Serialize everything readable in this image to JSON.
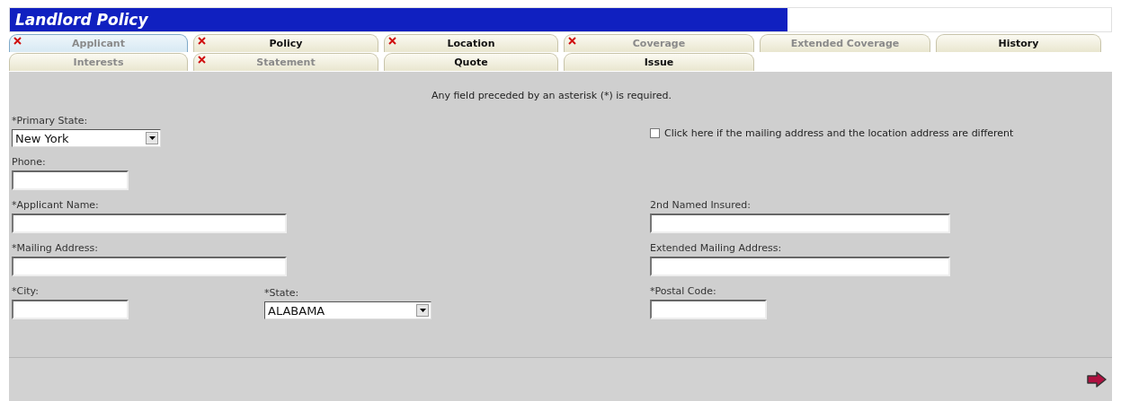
{
  "window": {
    "title": "Landlord Policy"
  },
  "tab_rows": [
    {
      "tabs": [
        {
          "label": "Applicant",
          "selected": true,
          "error": true,
          "disabled": true
        },
        {
          "label": "Policy",
          "selected": false,
          "error": true,
          "disabled": false
        },
        {
          "label": "Location",
          "selected": false,
          "error": true,
          "disabled": false
        },
        {
          "label": "Coverage",
          "selected": false,
          "error": true,
          "disabled": true
        },
        {
          "label": "Extended Coverage",
          "selected": false,
          "error": false,
          "disabled": true
        },
        {
          "label": "History",
          "selected": false,
          "error": false,
          "disabled": false
        }
      ]
    },
    {
      "tabs": [
        {
          "label": "Interests",
          "selected": false,
          "error": false,
          "disabled": true
        },
        {
          "label": "Statement",
          "selected": false,
          "error": true,
          "disabled": true
        },
        {
          "label": "Quote",
          "selected": false,
          "error": false,
          "disabled": false
        },
        {
          "label": "Issue",
          "selected": false,
          "error": false,
          "disabled": false
        }
      ]
    }
  ],
  "form": {
    "note": "Any field preceded by an asterisk (*) is required.",
    "rows": [
      {
        "cells": [
          {
            "kind": "select",
            "label": "*Primary State:",
            "value": "New York"
          },
          null,
          {
            "kind": "checkbox",
            "label": "Click here if the mailing address and the location address are different",
            "checked": false
          }
        ]
      },
      {
        "cells": [
          {
            "kind": "text",
            "label": "Phone:"
          },
          null,
          null
        ]
      },
      {
        "cells": [
          {
            "kind": "text",
            "label": "*Applicant Name:"
          },
          null,
          {
            "kind": "text",
            "label": "2nd Named Insured:"
          }
        ]
      },
      {
        "cells": [
          {
            "kind": "text",
            "label": "*Mailing Address:"
          },
          null,
          {
            "kind": "text",
            "label": "Extended Mailing Address:"
          }
        ]
      },
      {
        "cells": [
          {
            "kind": "text",
            "label": "*City:"
          },
          {
            "kind": "select",
            "label": "*State:",
            "value": "ALABAMA"
          },
          {
            "kind": "text",
            "label": "*Postal Code:"
          }
        ]
      }
    ]
  }
}
